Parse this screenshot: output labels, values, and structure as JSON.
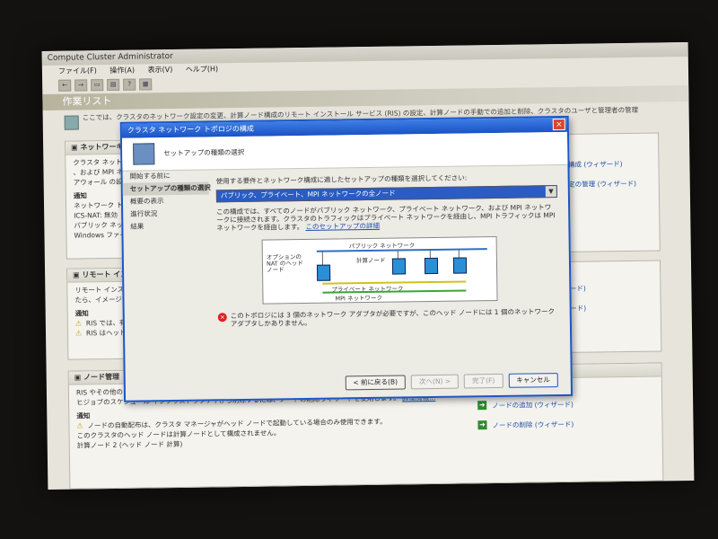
{
  "window": {
    "title": "Compute Cluster Administrator"
  },
  "menu": [
    "ファイル(F)",
    "操作(A)",
    "表示(V)",
    "ヘルプ(H)"
  ],
  "page_header": "作業リスト",
  "intro_text": "ここでは、クラスタのネットワーク設定の変更、計算ノード構成のリモート インストール サービス (RIS) の設定、計算ノードの手動での追加と削除、クラスタのユーザと管理者の管理",
  "networking_panel": {
    "title": "ネットワーキング",
    "lines": [
      "クラスタ ネットワーク トポロジ",
      "、および MPI ネットワーク",
      "アウォール の設定を管理"
    ],
    "notice_title": "通知",
    "items": [
      "ネットワーク トポロジ: パブ",
      "ICS-NAT: 無効",
      "パブリック ネットワーク: 192",
      "Windows ファイアウォール"
    ]
  },
  "ris_panel": {
    "title": "リモート インストール サ",
    "lines": [
      "リモート インストール サービ",
      "たら、イメージの管理ウィザ"
    ],
    "notice_title": "通知",
    "warnings": [
      "RIS では、有効な IP アド",
      "RIS はヘッド ノードから直"
    ]
  },
  "node_panel": {
    "title": "ノード管理",
    "line1": "RIS やその他の自動配布",
    "line2": "ヒジョブのスケジュール インフラストラクチャから削除するには、ノードの削除ウィザードを使用します。",
    "link": "詳細情報...",
    "notice_title": "通知",
    "warning": "ノードの自動配布は、クラスタ マネージャがヘッド ノードで起動している場合のみ使用できます。",
    "info": "このクラスタのヘッド ノードは計算ノードとして構成されません。",
    "cut": "計算ノード 2 (ヘッド ノード 計算)"
  },
  "right_links_top": [
    "の構成 (ウィザード)",
    "設定の管理 (ウィザード)"
  ],
  "right_links_mid": [
    "ザード)",
    "ザード)"
  ],
  "right_links_bottom": [
    "ノードの追加 (ウィザード)",
    "ノードの削除 (ウィザード)"
  ],
  "dialog": {
    "title": "クラスタ ネットワーク トポロジの構成",
    "close": "×",
    "header": "セットアップの種類の選択",
    "nav": [
      "開始する前に",
      "セットアップの種類の選択",
      "概要の表示",
      "進行状況",
      "結果"
    ],
    "instruction": "使用する要件とネットワーク構成に適したセットアップの種類を選択してください:",
    "selected_option": "パブリック、プライベート、MPI ネットワークの全ノード",
    "description": "この構成では、すべてのノードがパブリック ネットワーク、プライベート ネットワーク、および MPI ネットワークに接続されます。クラスタのトラフィックはプライベート ネットワークを経由し、MPI トラフィックは MPI ネットワークを経由します。",
    "description_link": "このセットアップの詳細",
    "diagram": {
      "public_label": "パブリック ネットワーク",
      "head_label": "オプションの NAT のヘッド ノード",
      "compute_label": "計算ノード",
      "private_label": "プライベート ネットワーク",
      "mpi_label": "MPI ネットワーク"
    },
    "error": "このトポロジには 3 個のネットワーク アダプタが必要ですが、このヘッド ノードには 1 個のネットワーク アダプタしかありません。",
    "buttons": {
      "back": "< 前に戻る(B)",
      "next": "次へ(N) >",
      "finish": "完了(F)",
      "cancel": "キャンセル"
    }
  },
  "colors": {
    "dialog_title": "#1b52c4",
    "selection": "#2a5cc4",
    "public_net": "#2f6fc4",
    "private_net": "#d2c21c",
    "mpi_net": "#3aa63a"
  }
}
